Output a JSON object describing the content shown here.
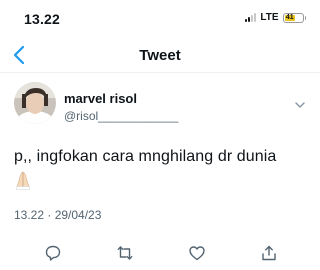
{
  "status_bar": {
    "time": "13.22",
    "network": "LTE",
    "battery_level": "41",
    "battery_color": "#e8c21a"
  },
  "nav": {
    "back_icon": "chevron-left-icon",
    "title": "Tweet"
  },
  "tweet": {
    "author_name": "marvel risol",
    "author_handle": "@risol____________",
    "text": "p,, ingfokan cara mnghilang dr dunia",
    "emoji": "folded-hands-icon",
    "timestamp": "13.22 · 29/04/23",
    "more_icon": "chevron-down-icon"
  },
  "actions": [
    "reply-icon",
    "retweet-icon",
    "like-icon",
    "share-icon"
  ],
  "colors": {
    "accent": "#1d9bf0",
    "text_primary": "#0f1419",
    "text_secondary": "#536471"
  }
}
